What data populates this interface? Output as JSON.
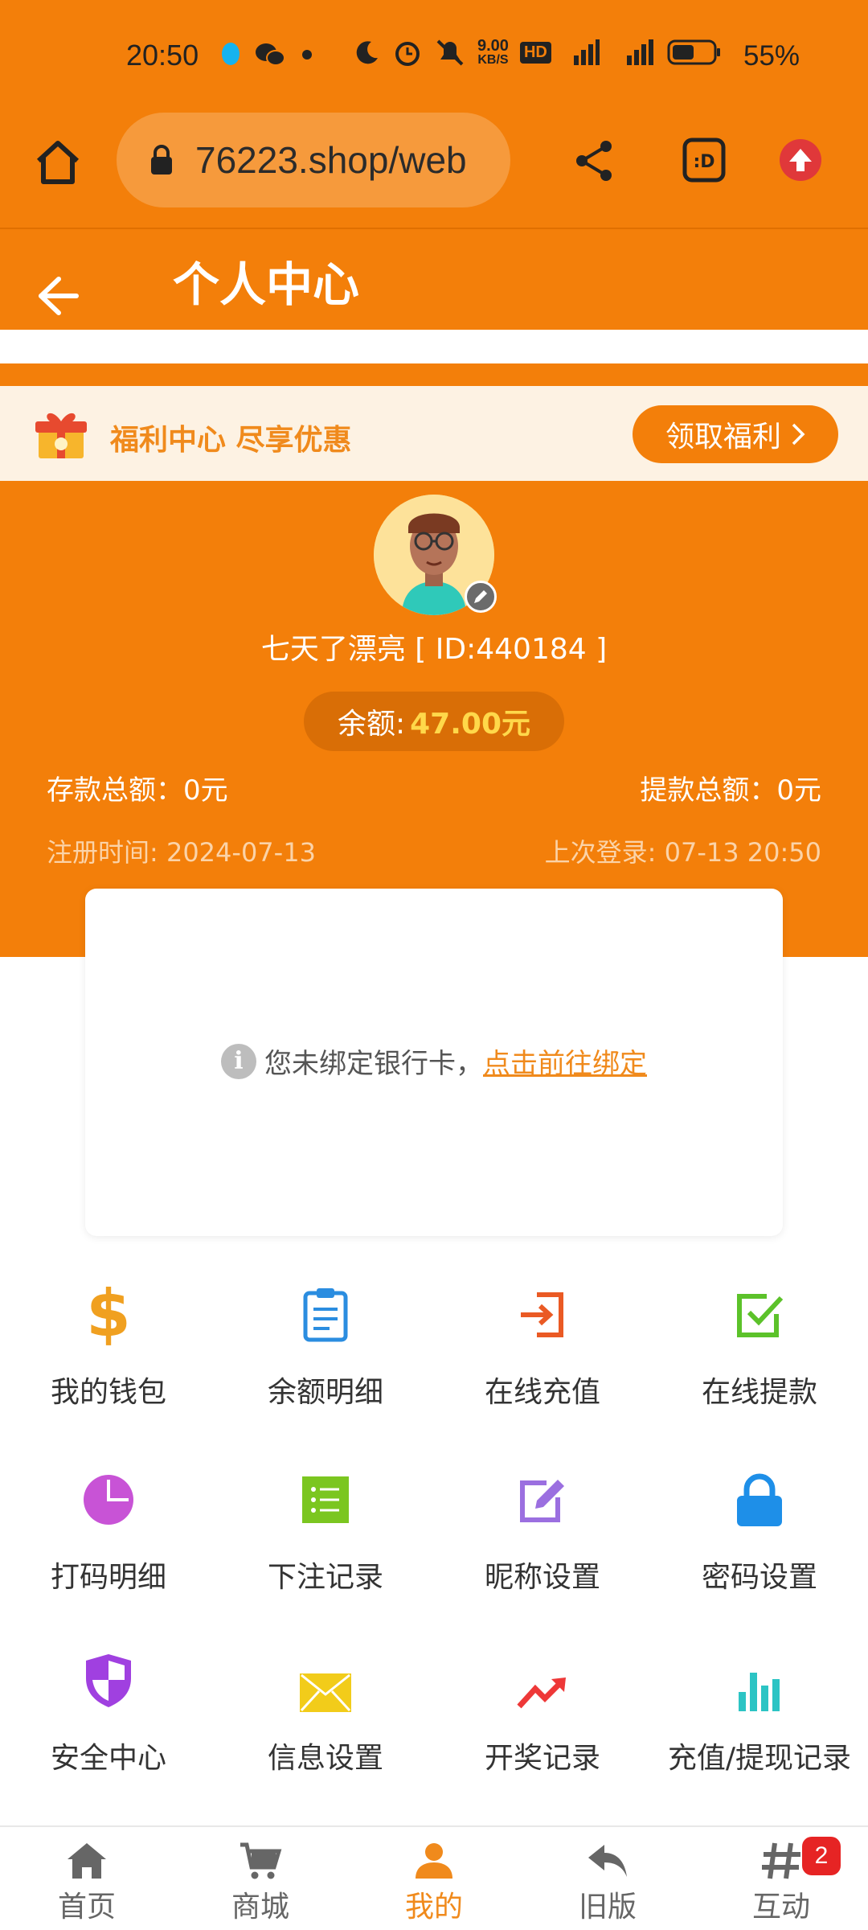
{
  "status_bar": {
    "time": "20:50",
    "net_speed_top": "9.00",
    "net_speed_bottom": "KB/S",
    "hd": "HD",
    "battery": "55%"
  },
  "browser": {
    "url": "76223.shop/web"
  },
  "header": {
    "title": "个人中心"
  },
  "welfare": {
    "text": "福利中心 尽享优惠",
    "button": "领取福利"
  },
  "profile": {
    "name": "七天了漂亮 [ ID:440184 ]",
    "balance_label": "余额:",
    "balance_value": "47.00元",
    "deposit_total": "存款总额：0元",
    "withdraw_total": "提款总额：0元",
    "register_time": "注册时间: 2024-07-13",
    "last_login": "上次登录: 07-13 20:50"
  },
  "bank_card": {
    "message": "您未绑定银行卡，",
    "link": "点击前往绑定"
  },
  "menu": [
    {
      "label": "我的钱包",
      "icon": "dollar-icon",
      "color": "#f0a020"
    },
    {
      "label": "余额明细",
      "icon": "clipboard-icon",
      "color": "#2b8de0"
    },
    {
      "label": "在线充值",
      "icon": "login-icon",
      "color": "#ea5a24"
    },
    {
      "label": "在线提款",
      "icon": "checkbox-icon",
      "color": "#5cc22a"
    },
    {
      "label": "打码明细",
      "icon": "pie-chart-icon",
      "color": "#c853d6"
    },
    {
      "label": "下注记录",
      "icon": "list-icon",
      "color": "#7bc620"
    },
    {
      "label": "昵称设置",
      "icon": "edit-icon",
      "color": "#9b6fe0"
    },
    {
      "label": "密码设置",
      "icon": "lock-icon",
      "color": "#1e8fe8"
    },
    {
      "label": "安全中心",
      "icon": "shield-icon",
      "color": "#a040e0"
    },
    {
      "label": "信息设置",
      "icon": "mail-icon",
      "color": "#f2cc1a"
    },
    {
      "label": "开奖记录",
      "icon": "trend-icon",
      "color": "#ee3838"
    },
    {
      "label": "充值/提现记录",
      "icon": "bar-chart-icon",
      "color": "#2cc4c4"
    }
  ],
  "bottom_nav": [
    {
      "label": "首页",
      "icon": "home-icon"
    },
    {
      "label": "商城",
      "icon": "cart-icon"
    },
    {
      "label": "我的",
      "icon": "user-icon"
    },
    {
      "label": "旧版",
      "icon": "reply-icon"
    },
    {
      "label": "互动",
      "icon": "hash-icon",
      "badge": "2"
    }
  ],
  "colors": {
    "brand": "#f37f0a",
    "accent": "#f08a1c",
    "balance_value": "#ffd84a"
  }
}
